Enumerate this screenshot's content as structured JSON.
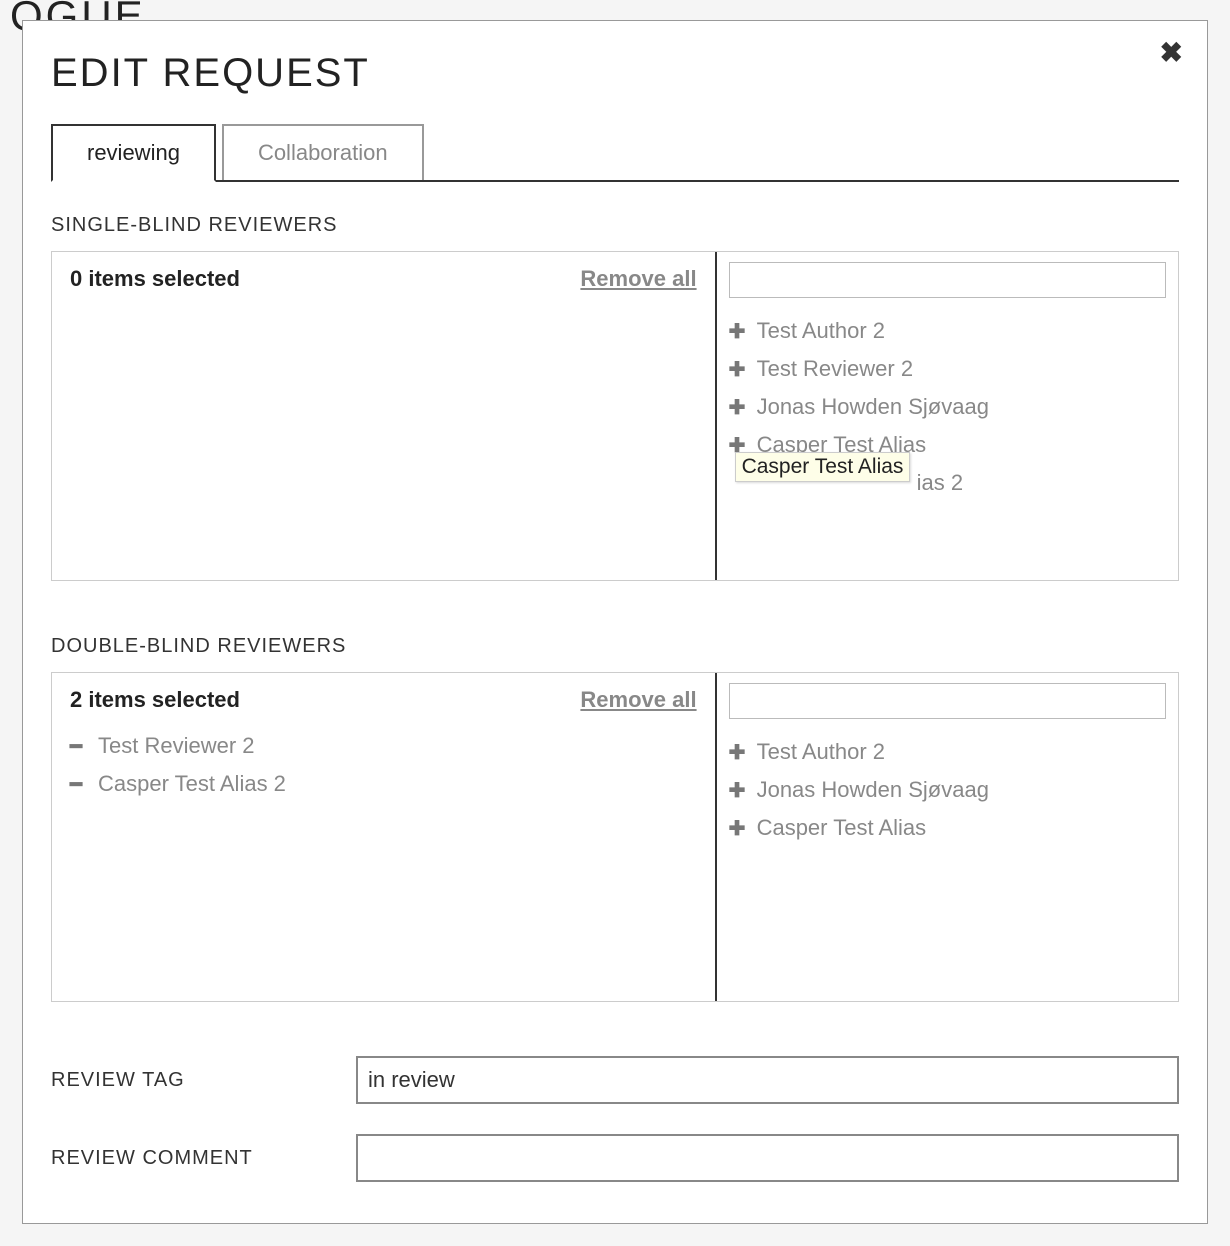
{
  "bg": "OGUE",
  "modal": {
    "title": "EDIT REQUEST",
    "close_glyph": "✖"
  },
  "tabs": {
    "reviewing": "reviewing",
    "collaboration": "Collaboration"
  },
  "single": {
    "label": "SINGLE-BLIND REVIEWERS",
    "selected_text": "0 items selected",
    "remove_all": "Remove all",
    "available": [
      "Test Author 2",
      "Test Reviewer 2",
      "Jonas Howden Sjøvaag",
      "Casper Test Alias",
      "Casper Test Alias 2"
    ],
    "tooltip": "Casper Test Alias",
    "partial_visible": "ias 2"
  },
  "double": {
    "label": "DOUBLE-BLIND REVIEWERS",
    "selected_text": "2 items selected",
    "remove_all": "Remove all",
    "selected": [
      "Test Reviewer 2",
      "Casper Test Alias 2"
    ],
    "available": [
      "Test Author 2",
      "Jonas Howden Sjøvaag",
      "Casper Test Alias"
    ]
  },
  "form": {
    "review_tag_label": "REVIEW TAG",
    "review_tag_value": "in review",
    "review_comment_label": "REVIEW COMMENT"
  }
}
